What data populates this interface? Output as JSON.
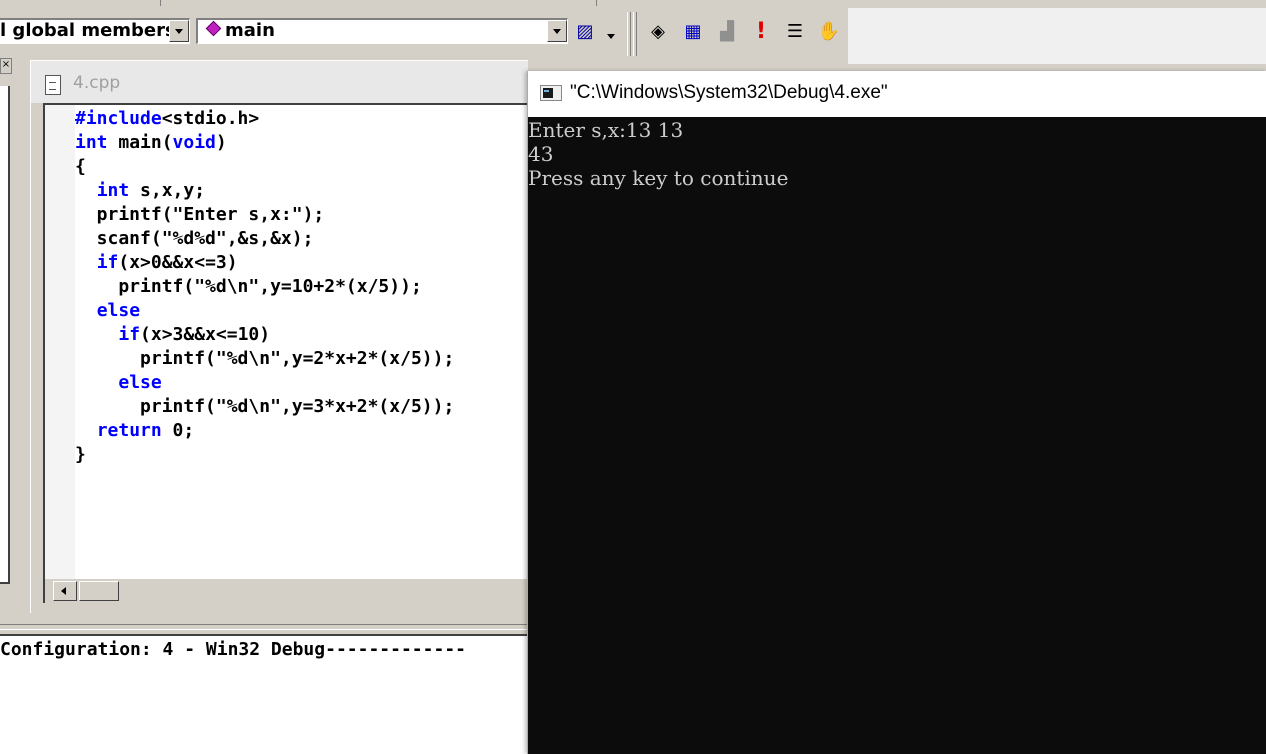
{
  "toolbar": {
    "scope_combo_value": "l global members",
    "function_combo_value": "main",
    "buttons": [
      {
        "name": "wizard-action-icon",
        "glyph": "▨"
      },
      {
        "name": "compile-icon",
        "glyph": "◈"
      },
      {
        "name": "build-icon",
        "glyph": "▦"
      },
      {
        "name": "stop-build-icon",
        "glyph": "▟"
      },
      {
        "name": "execute-icon",
        "glyph": "!"
      },
      {
        "name": "step-into-icon",
        "glyph": "☰"
      },
      {
        "name": "breakpoint-hand-icon",
        "glyph": "✋"
      }
    ]
  },
  "workspace": {
    "close_glyph": "×"
  },
  "editor": {
    "title": "4.cpp",
    "lines": [
      [
        {
          "t": "#include",
          "k": true
        },
        {
          "t": "<stdio.h>",
          "k": false
        }
      ],
      [
        {
          "t": "int",
          "k": true
        },
        {
          "t": " main(",
          "k": false
        },
        {
          "t": "void",
          "k": true
        },
        {
          "t": ")",
          "k": false
        }
      ],
      [
        {
          "t": "{",
          "k": false
        }
      ],
      [
        {
          "t": "  ",
          "k": false
        },
        {
          "t": "int",
          "k": true
        },
        {
          "t": " s,x,y;",
          "k": false
        }
      ],
      [
        {
          "t": "  printf(\"Enter s,x:\");",
          "k": false
        }
      ],
      [
        {
          "t": "  scanf(\"%d%d\",&s,&x);",
          "k": false
        }
      ],
      [
        {
          "t": "  ",
          "k": false
        },
        {
          "t": "if",
          "k": true
        },
        {
          "t": "(x>0&&x<=3)",
          "k": false
        }
      ],
      [
        {
          "t": "    printf(\"%d\\n\",y=10+2*(x/5));",
          "k": false
        }
      ],
      [
        {
          "t": "  ",
          "k": false
        },
        {
          "t": "else",
          "k": true
        }
      ],
      [
        {
          "t": "    ",
          "k": false
        },
        {
          "t": "if",
          "k": true
        },
        {
          "t": "(x>3&&x<=10)",
          "k": false
        }
      ],
      [
        {
          "t": "      printf(\"%d\\n\",y=2*x+2*(x/5));",
          "k": false
        }
      ],
      [
        {
          "t": "    ",
          "k": false
        },
        {
          "t": "else",
          "k": true
        }
      ],
      [
        {
          "t": "      printf(\"%d\\n\",y=3*x+2*(x/5));",
          "k": false
        }
      ],
      [
        {
          "t": "  ",
          "k": false
        },
        {
          "t": "return",
          "k": true
        },
        {
          "t": " 0;",
          "k": false
        }
      ],
      [
        {
          "t": "}",
          "k": false
        }
      ]
    ]
  },
  "output": {
    "line": "Configuration: 4 - Win32 Debug-------------"
  },
  "console": {
    "title": "\"C:\\Windows\\System32\\Debug\\4.exe\"",
    "lines": [
      "Enter s,x:13 13",
      "43",
      "Press any key to continue"
    ]
  },
  "colors": {
    "keyword": "#0000ff",
    "console_bg": "#0c0c0c",
    "console_text": "#cccccc",
    "chrome": "#d4d0c8"
  }
}
